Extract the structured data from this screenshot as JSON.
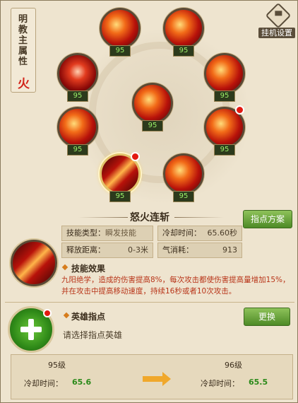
{
  "attribute": {
    "title": "明教主属性",
    "value": "火"
  },
  "settings": {
    "label": "挂机设置"
  },
  "skills": [
    {
      "level": "95",
      "selected": false,
      "badge": false
    },
    {
      "level": "95",
      "selected": false,
      "badge": false
    },
    {
      "level": "95",
      "selected": false,
      "badge": false
    },
    {
      "level": "95",
      "selected": false,
      "badge": false
    },
    {
      "level": "95",
      "selected": false,
      "badge": false
    },
    {
      "level": "95",
      "selected": false,
      "badge": false
    },
    {
      "level": "95",
      "selected": false,
      "badge": true
    },
    {
      "level": "95",
      "selected": true,
      "badge": true
    },
    {
      "level": "95",
      "selected": false,
      "badge": false
    }
  ],
  "detail": {
    "name": "怒火连斩",
    "plan_button": "指点方案",
    "type_label": "技能类型：",
    "type_value": "瞬发技能",
    "cd_label": "冷却时间：",
    "cd_value": "65.60秒",
    "range_label": "释放距离：",
    "range_value": "0-3米",
    "qi_label": "气消耗：",
    "qi_value": "913",
    "effect_title": "技能效果",
    "effect_text": "九阳绝学，造成的伤害提高8%，每次攻击都使伤害提高量增加15%，并在攻击中提高移动速度，持续16秒或者10次攻击。"
  },
  "hero": {
    "title": "英雄指点",
    "hint": "请选择指点英雄",
    "swap_button": "更换"
  },
  "compare": {
    "current_level": "95级",
    "next_level": "96级",
    "cd_label": "冷却时间：",
    "current_cd": "65.6",
    "next_cd": "65.5"
  }
}
